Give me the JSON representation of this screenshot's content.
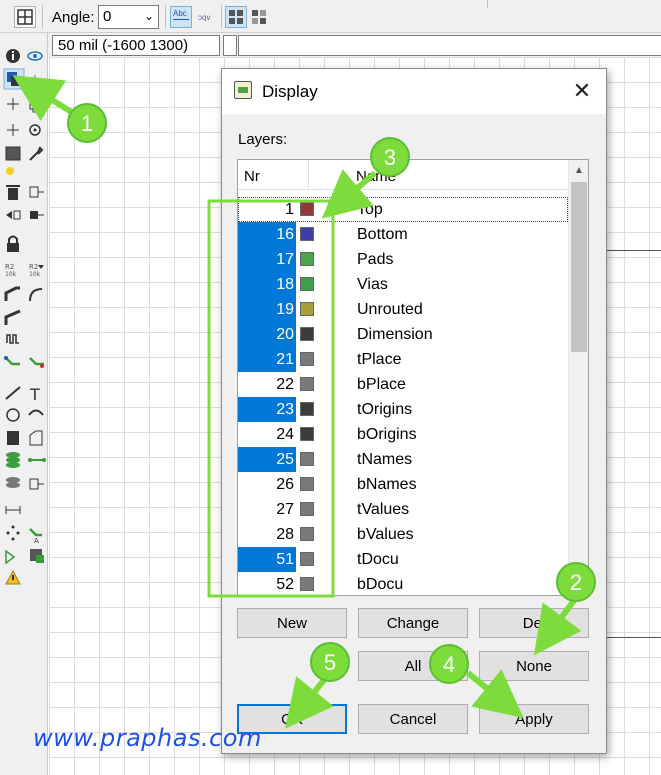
{
  "toolbar": {
    "angle_label": "Angle:",
    "angle_value": "0",
    "mirror_left_label": "Abc",
    "mirror_right_label": "ɔqv"
  },
  "coord_display": "50 mil (-1600 1300)",
  "dialog": {
    "title": "Display",
    "close_glyph": "✕",
    "layers_label": "Layers:",
    "header_nr": "Nr",
    "header_name": "Name",
    "rows": [
      {
        "nr": "1",
        "name": "Top",
        "color": "#8e3a3a",
        "selected": false
      },
      {
        "nr": "16",
        "name": "Bottom",
        "color": "#3e3ea6",
        "selected": true
      },
      {
        "nr": "17",
        "name": "Pads",
        "color": "#4aa64a",
        "selected": true
      },
      {
        "nr": "18",
        "name": "Vias",
        "color": "#3ea04a",
        "selected": true
      },
      {
        "nr": "19",
        "name": "Unrouted",
        "color": "#a6a03a",
        "selected": true
      },
      {
        "nr": "20",
        "name": "Dimension",
        "color": "#3c3c3c",
        "selected": true
      },
      {
        "nr": "21",
        "name": "tPlace",
        "color": "#7a7a7a",
        "selected": true
      },
      {
        "nr": "22",
        "name": "bPlace",
        "color": "#7a7a7a",
        "selected": false
      },
      {
        "nr": "23",
        "name": "tOrigins",
        "color": "#3c3c3c",
        "selected": true
      },
      {
        "nr": "24",
        "name": "bOrigins",
        "color": "#3c3c3c",
        "selected": false
      },
      {
        "nr": "25",
        "name": "tNames",
        "color": "#7a7a7a",
        "selected": true
      },
      {
        "nr": "26",
        "name": "bNames",
        "color": "#7a7a7a",
        "selected": false
      },
      {
        "nr": "27",
        "name": "tValues",
        "color": "#7a7a7a",
        "selected": false
      },
      {
        "nr": "28",
        "name": "bValues",
        "color": "#7a7a7a",
        "selected": false
      },
      {
        "nr": "51",
        "name": "tDocu",
        "color": "#7a7a7a",
        "selected": true
      },
      {
        "nr": "52",
        "name": "bDocu",
        "color": "#7a7a7a",
        "selected": false
      }
    ],
    "buttons": {
      "new": "New",
      "change": "Change",
      "del": "Del",
      "all": "All",
      "none": "None",
      "ok": "OK",
      "cancel": "Cancel",
      "apply": "Apply"
    }
  },
  "annotations": {
    "step1": "1",
    "step2": "2",
    "step3": "3",
    "step4": "4",
    "step5": "5",
    "color": "#7ddc3c",
    "border_color": "#5abf30"
  },
  "watermark": "www.praphas.com",
  "icons": [
    "grid-icon",
    "info-icon",
    "eye-icon",
    "display-layers-icon",
    "move-icon",
    "copy-icon",
    "mirror-icon",
    "rotate-icon",
    "group-icon",
    "wrench-icon",
    "delete-icon",
    "lock-icon",
    "text-icon",
    "circle-icon",
    "arc-icon",
    "rectangle-icon",
    "polygon-icon",
    "via-icon",
    "signal-icon",
    "warning-icon"
  ]
}
